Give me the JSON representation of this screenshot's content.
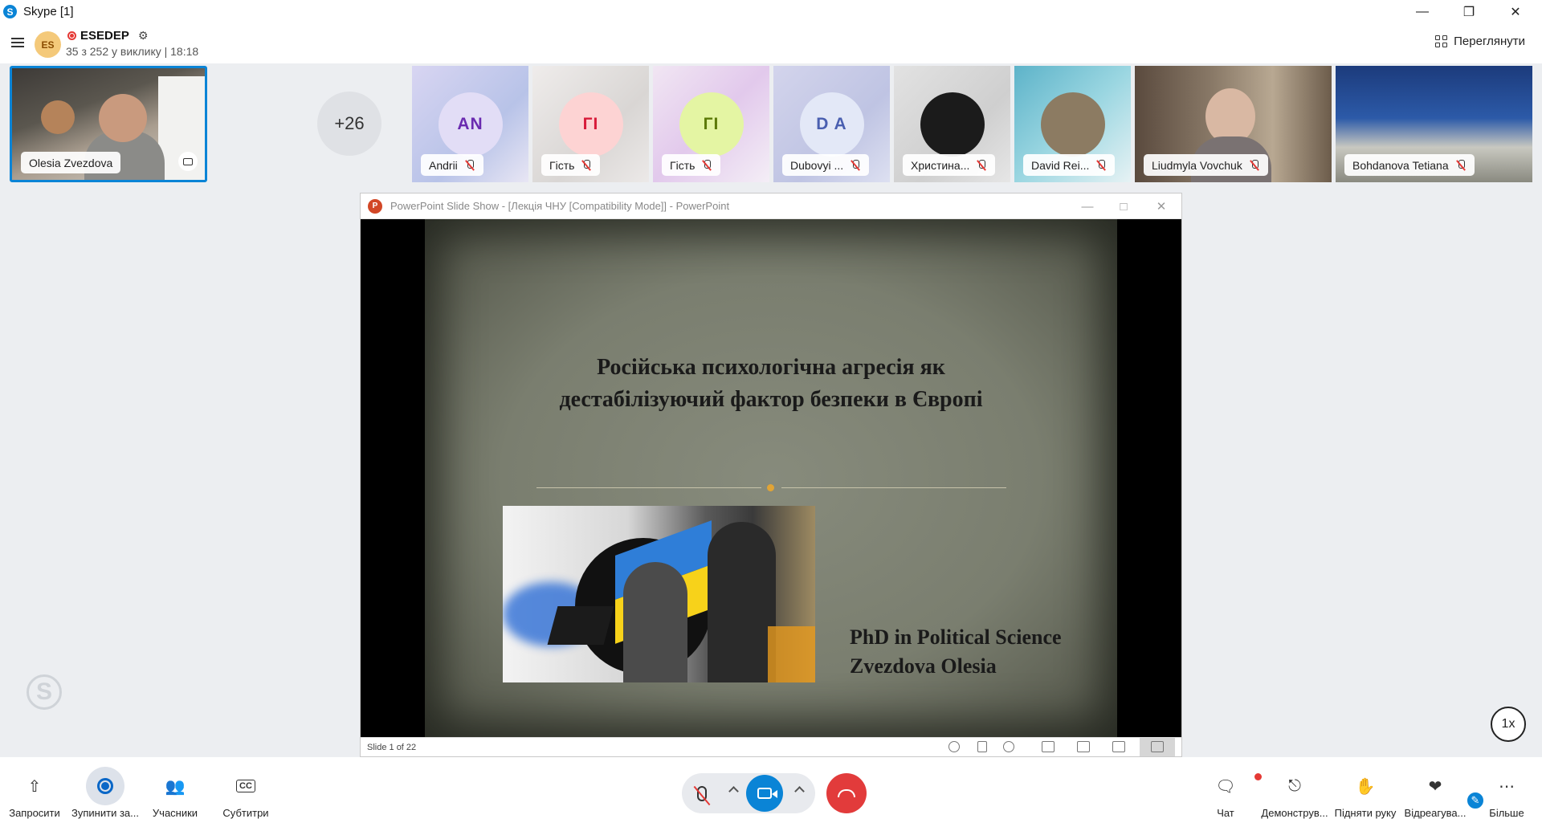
{
  "window": {
    "title": "Skype [1]",
    "app_icon": "S"
  },
  "header": {
    "avatar_initials": "ES",
    "conversation_name": "ESEDEP",
    "subtitle": "35 з 252 у виклику | 18:18",
    "view_label": "Переглянути"
  },
  "participants": {
    "self_name": "Olesia Zvezdova",
    "more_count": "+26",
    "tiles": [
      {
        "name": "Andrii",
        "initials": "AN",
        "avatar_bg": "#d7d3f2",
        "initials_color": "#6a2bb0",
        "tile_bg": "#c9c5e6"
      },
      {
        "name": "Гість",
        "initials": "ГІ",
        "avatar_bg": "#fdd6d6",
        "initials_color": "#d81b3a",
        "tile_bg": "#e6e3e2"
      },
      {
        "name": "Гість",
        "initials": "ГІ",
        "avatar_bg": "#e6f5a6",
        "initials_color": "#5c7a08",
        "tile_bg": "#e8d9ec"
      },
      {
        "name": "Dubovyi ...",
        "initials": "D A",
        "avatar_bg": "#dfe5f6",
        "initials_color": "#4a5fb0",
        "tile_bg": "#c8cbe3"
      },
      {
        "name": "Христина...",
        "initials": "",
        "avatar_bg": "#1b1b1b",
        "initials_color": "#fff",
        "tile_bg": "#d8d8d8"
      },
      {
        "name": "David Rei...",
        "initials": "",
        "avatar_bg": "#8c7b62",
        "initials_color": "#fff",
        "tile_bg": "#7fc8d8"
      },
      {
        "name": "Liudmyla Vovchuk",
        "initials": "",
        "avatar_bg": "",
        "initials_color": "",
        "tile_bg": "#7c6a58"
      },
      {
        "name": "Bohdanova Tetiana",
        "initials": "",
        "avatar_bg": "",
        "initials_color": "",
        "tile_bg": "#274b8c"
      }
    ]
  },
  "presentation": {
    "window_title": "PowerPoint Slide Show - [Лекція ЧНУ [Compatibility Mode]] - PowerPoint",
    "slide_title_line1": "Російська психологічна агресія як",
    "slide_title_line2": "дестабілізуючий фактор безпеки в Європі",
    "credit_line1": "PhD in Political Science",
    "credit_line2": "Zvezdova Olesia",
    "status": "Slide 1 of 22"
  },
  "playback": {
    "speed": "1x"
  },
  "toolbar": {
    "invite": "Запросити",
    "stop_recording": "Зупинити за...",
    "participants": "Учасники",
    "subtitles": "Субтитри",
    "chat": "Чат",
    "share": "Демонструв...",
    "raise_hand": "Підняти руку",
    "react": "Відреагува...",
    "more": "Більше",
    "subtitles_icon": "CC"
  },
  "colors": {
    "accent": "#0a84d6",
    "hangup": "#e23b3b",
    "record": "#e53935"
  }
}
